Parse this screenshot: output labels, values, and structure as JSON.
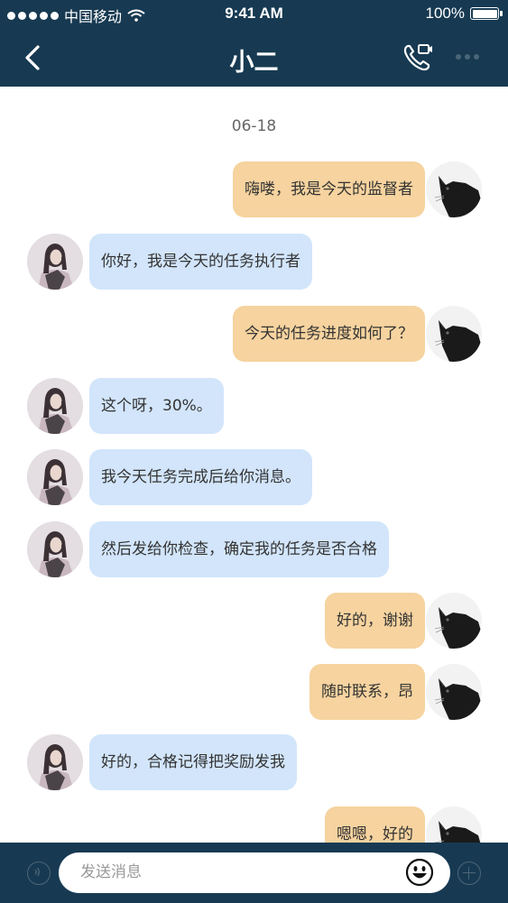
{
  "status_bar": {
    "carrier": "中国移动",
    "time": "9:41 AM",
    "battery": "100%",
    "signal_bars": 5
  },
  "nav": {
    "title": "小二",
    "back_icon": "chevron-left-icon",
    "call_icon": "phone-video-icon",
    "more_icon": "more-dots-icon"
  },
  "chat": {
    "date": "06-18",
    "messages": [
      {
        "side": "right",
        "text": "嗨喽，我是今天的监督者"
      },
      {
        "side": "left",
        "text": "你好，我是今天的任务执行者"
      },
      {
        "side": "right",
        "text": "今天的任务进度如何了？"
      },
      {
        "side": "left",
        "text": "这个呀，30%。"
      },
      {
        "side": "left",
        "text": "我今天任务完成后给你消息。"
      },
      {
        "side": "left",
        "text": "然后发给你检查，确定我的任务是否合格"
      },
      {
        "side": "right",
        "text": "好的，谢谢"
      },
      {
        "side": "right",
        "text": "随时联系，昂"
      },
      {
        "side": "left",
        "text": "好的，合格记得把奖励发我"
      },
      {
        "side": "right",
        "text": "嗯嗯，好的"
      }
    ]
  },
  "input": {
    "placeholder": "发送消息"
  },
  "colors": {
    "header_bg": "#173a52",
    "my_bubble": "#f6d39f",
    "their_bubble": "#d2e5fb"
  }
}
